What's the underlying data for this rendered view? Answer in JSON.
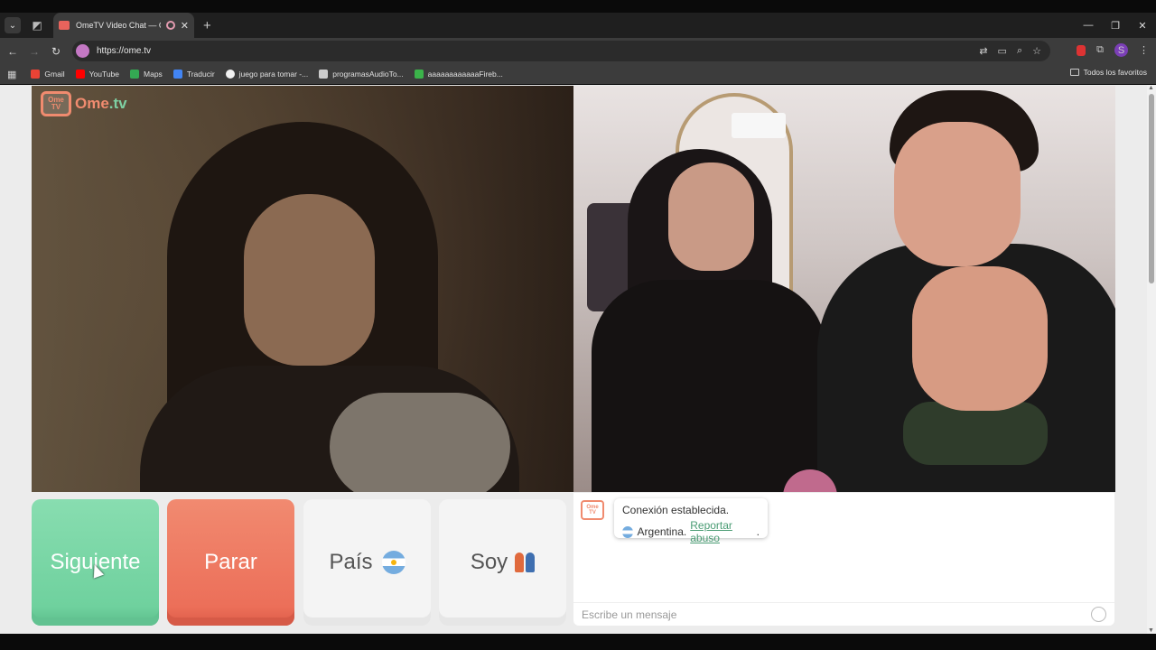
{
  "browser": {
    "tab_title": "OmeTV Video Chat — Ome",
    "url": "https://ome.tv",
    "profile_initial": "S"
  },
  "bookmarks": {
    "items": [
      {
        "label": "Gmail",
        "icon": "gmail-icon",
        "color": "#ea4335"
      },
      {
        "label": "YouTube",
        "icon": "youtube-icon",
        "color": "#ff0000"
      },
      {
        "label": "Maps",
        "icon": "maps-icon",
        "color": "#34a853"
      },
      {
        "label": "Traducir",
        "icon": "translate-icon",
        "color": "#4285f4"
      },
      {
        "label": "juego para tomar -...",
        "icon": "google-icon",
        "color": "#f1f1f1"
      },
      {
        "label": "programasAudioTo...",
        "icon": "bookmark-icon",
        "color": "#cccccc"
      },
      {
        "label": "aaaaaaaaaaaaFireb...",
        "icon": "firebase-icon",
        "color": "#3bb34a"
      }
    ],
    "all_label": "Todos los favoritos"
  },
  "page": {
    "logo_text_a": "Ome",
    "logo_text_b": ".tv",
    "logo_tv": "Ome TV"
  },
  "buttons": {
    "next": "Siguiente",
    "stop": "Parar",
    "country": "País",
    "gender": "Soy"
  },
  "chat": {
    "status": "Conexión establecida.",
    "country": "Argentina.",
    "report": "Reportar abuso",
    "report_suffix": ".",
    "placeholder": "Escribe un mensaje"
  },
  "colors": {
    "next": "#6fd19e",
    "stop": "#ec6f59",
    "brand_orange": "#f08b6f",
    "brand_green": "#7ed0a3"
  }
}
